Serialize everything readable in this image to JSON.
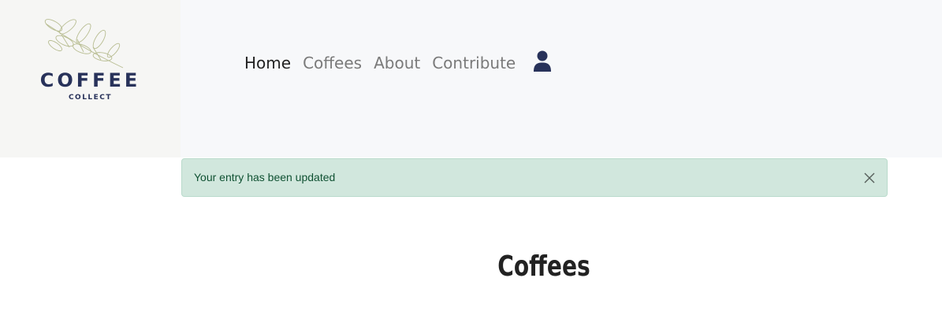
{
  "logo": {
    "title": "COFFEE",
    "subtitle": "COLLECT",
    "icon": "coffee-branch-icon"
  },
  "nav": {
    "items": [
      {
        "label": "Home",
        "active": true
      },
      {
        "label": "Coffees",
        "active": false
      },
      {
        "label": "About",
        "active": false
      },
      {
        "label": "Contribute",
        "active": false
      }
    ],
    "account_icon": "user-icon"
  },
  "alert": {
    "message": "Your entry has been updated",
    "close_icon": "close-icon"
  },
  "main": {
    "heading": "Coffees"
  },
  "colors": {
    "navbar_bg": "#f7f8fa",
    "brand_navy": "#28325a",
    "alert_bg": "#d1e7dd",
    "alert_text": "#0f5132",
    "nav_active": "#222222",
    "nav_inactive": "#7a7a7a"
  }
}
